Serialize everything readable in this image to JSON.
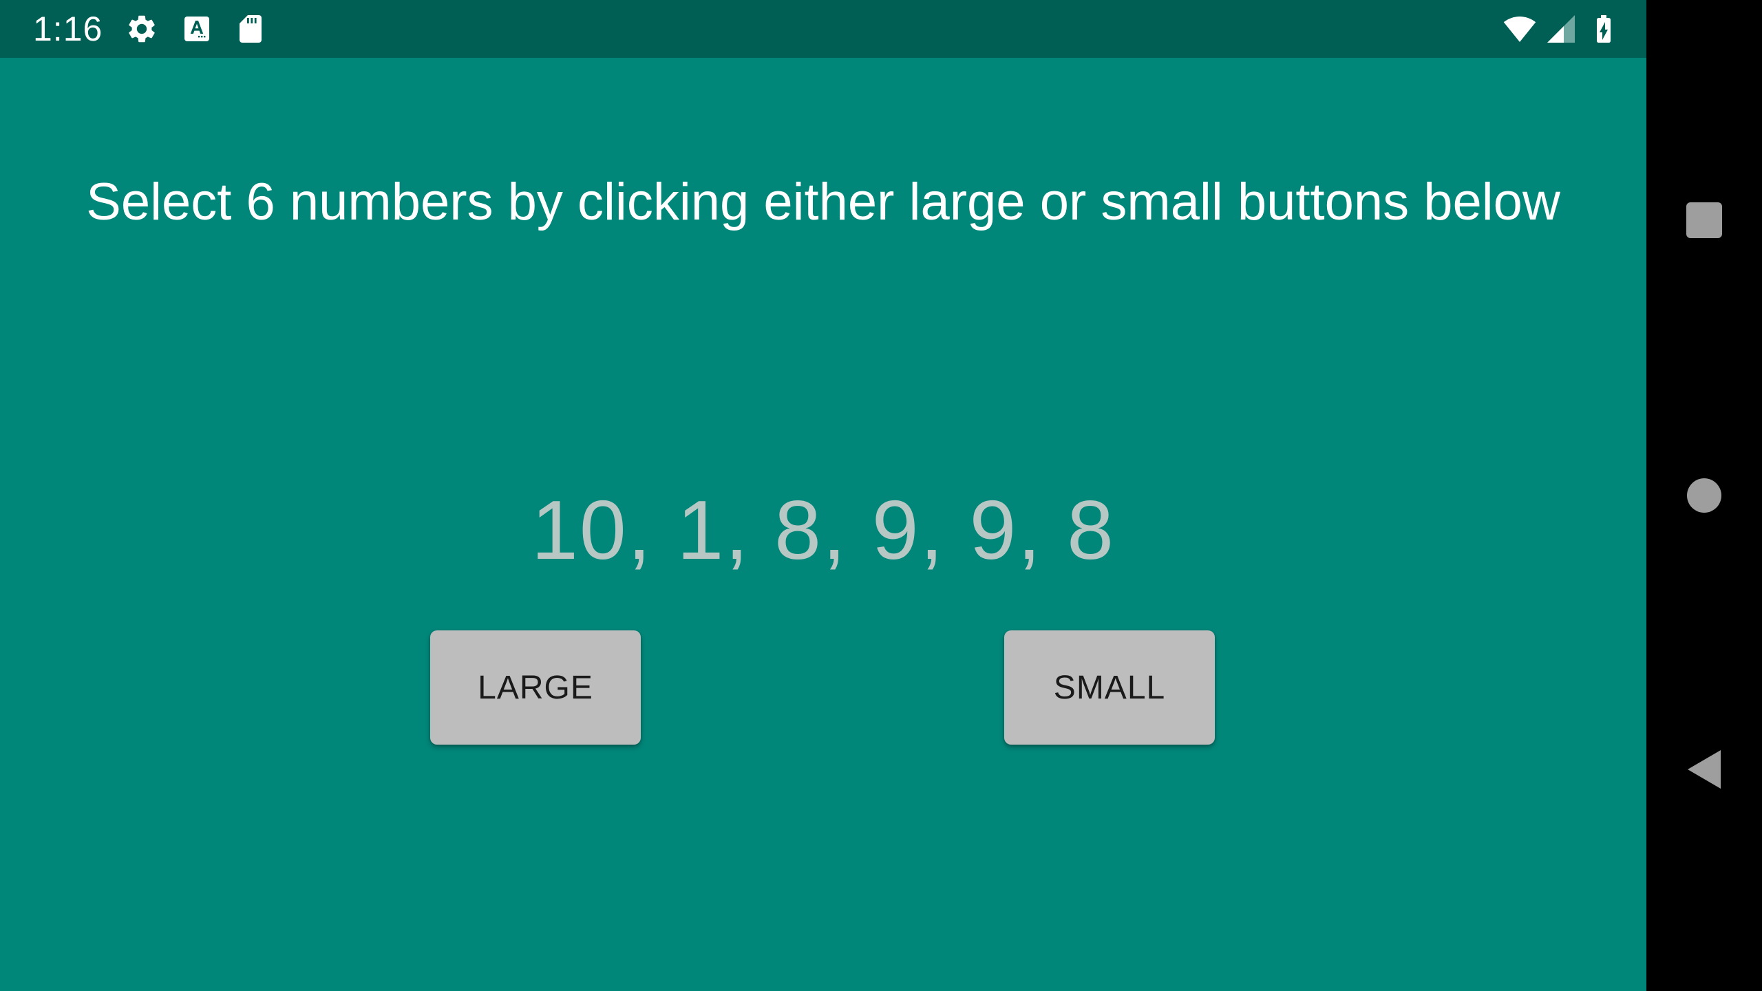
{
  "status_bar": {
    "time": "1:16",
    "icons": [
      "gear-icon",
      "text-a-icon",
      "sd-card-icon",
      "wifi-icon",
      "cell-signal-icon",
      "battery-charging-icon"
    ]
  },
  "main": {
    "instruction": "Select 6 numbers by clicking either large or small buttons below",
    "numbers": "10, 1, 8, 9, 9, 8",
    "large_button_label": "LARGE",
    "small_button_label": "SMALL"
  },
  "nav_bar": {
    "buttons": [
      "recents",
      "home",
      "back"
    ]
  },
  "colors": {
    "background": "#00877a",
    "status_bar": "#005f55",
    "button": "#bdbdbd",
    "numbers_text": "#b7c7c4",
    "instruction_text": "#ffffff"
  }
}
